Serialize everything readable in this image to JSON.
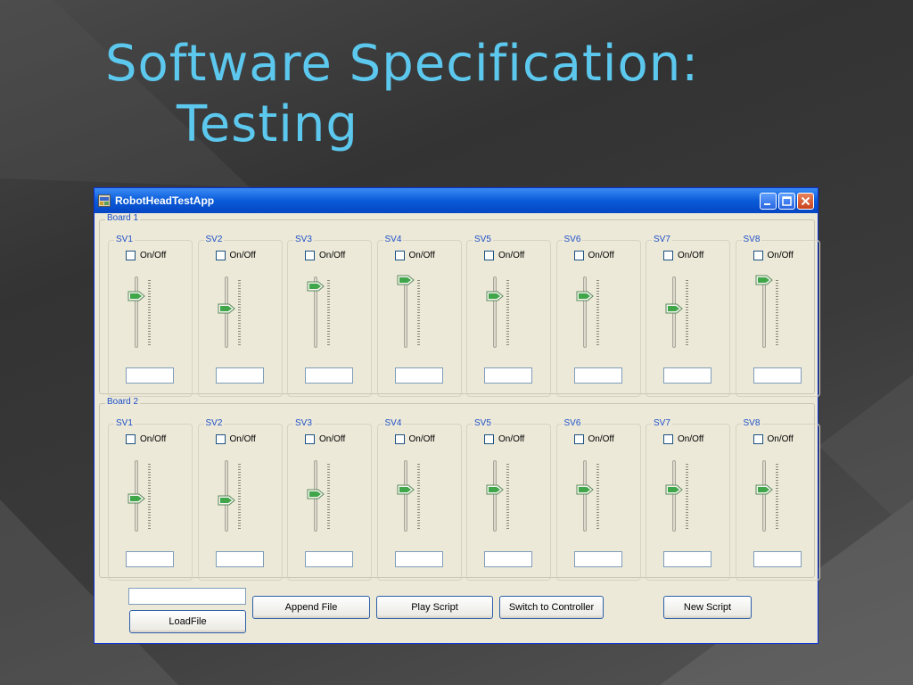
{
  "slide": {
    "title_line1": "Software Specification:",
    "title_line2": "Testing"
  },
  "window": {
    "title": "RobotHeadTestApp",
    "icon": "app-window-icon",
    "title_bar_color": "#0a5bd8"
  },
  "boards": [
    {
      "label": "Board 1",
      "servos": [
        {
          "label": "SV1",
          "checkbox_label": "On/Off",
          "checked": false,
          "slider_level": 0.73,
          "value": ""
        },
        {
          "label": "SV2",
          "checkbox_label": "On/Off",
          "checked": false,
          "slider_level": 0.53,
          "value": ""
        },
        {
          "label": "SV3",
          "checkbox_label": "On/Off",
          "checked": false,
          "slider_level": 0.9,
          "value": ""
        },
        {
          "label": "SV4",
          "checkbox_label": "On/Off",
          "checked": false,
          "slider_level": 1.0,
          "value": ""
        },
        {
          "label": "SV5",
          "checkbox_label": "On/Off",
          "checked": false,
          "slider_level": 0.73,
          "value": ""
        },
        {
          "label": "SV6",
          "checkbox_label": "On/Off",
          "checked": false,
          "slider_level": 0.73,
          "value": ""
        },
        {
          "label": "SV7",
          "checkbox_label": "On/Off",
          "checked": false,
          "slider_level": 0.53,
          "value": ""
        },
        {
          "label": "SV8",
          "checkbox_label": "On/Off",
          "checked": false,
          "slider_level": 1.0,
          "value": ""
        }
      ]
    },
    {
      "label": "Board 2",
      "servos": [
        {
          "label": "SV1",
          "checkbox_label": "On/Off",
          "checked": false,
          "slider_level": 0.43,
          "value": ""
        },
        {
          "label": "SV2",
          "checkbox_label": "On/Off",
          "checked": false,
          "slider_level": 0.4,
          "value": ""
        },
        {
          "label": "SV3",
          "checkbox_label": "On/Off",
          "checked": false,
          "slider_level": 0.5,
          "value": ""
        },
        {
          "label": "SV4",
          "checkbox_label": "On/Off",
          "checked": false,
          "slider_level": 0.57,
          "value": ""
        },
        {
          "label": "SV5",
          "checkbox_label": "On/Off",
          "checked": false,
          "slider_level": 0.57,
          "value": ""
        },
        {
          "label": "SV6",
          "checkbox_label": "On/Off",
          "checked": false,
          "slider_level": 0.57,
          "value": ""
        },
        {
          "label": "SV7",
          "checkbox_label": "On/Off",
          "checked": false,
          "slider_level": 0.57,
          "value": ""
        },
        {
          "label": "SV8",
          "checkbox_label": "On/Off",
          "checked": false,
          "slider_level": 0.57,
          "value": ""
        }
      ]
    }
  ],
  "controls": {
    "file_input_value": "",
    "load_file": "LoadFile",
    "append_file": "Append File",
    "play_script": "Play Script",
    "switch_to_controller": "Switch to Controller",
    "new_script": "New Script"
  }
}
